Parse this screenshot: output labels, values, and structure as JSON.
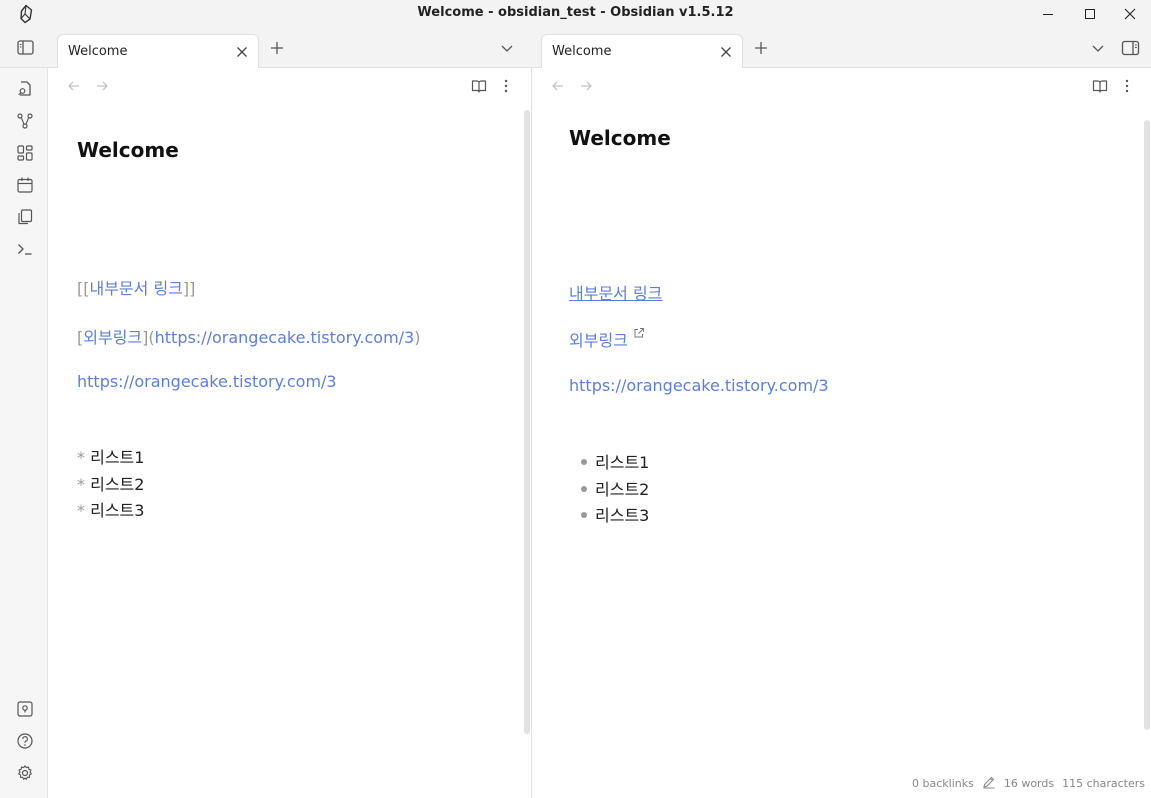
{
  "window": {
    "title": "Welcome - obsidian_test - Obsidian v1.5.12"
  },
  "icons": {
    "app_logo": "obsidian-logo-icon",
    "minimize": "minimize-icon",
    "maximize": "maximize-icon",
    "close": "close-icon",
    "sidebar_toggle": "left-sidebar-toggle-icon",
    "new_tab": "plus-icon",
    "tab_list": "chevron-down-icon",
    "right_sidebar_toggle": "right-sidebar-toggle-icon",
    "back": "arrow-left-icon",
    "forward": "arrow-right-icon",
    "reading_mode": "book-open-icon",
    "more": "more-vertical-icon",
    "edit": "pencil-icon"
  },
  "tabs": {
    "left": {
      "label": "Welcome"
    },
    "right": {
      "label": "Welcome"
    }
  },
  "ribbon": {
    "top_items": [
      "open-quick-switcher-icon",
      "graph-view-icon",
      "canvas-icon",
      "daily-notes-icon",
      "templates-icon",
      "command-palette-icon"
    ],
    "bottom_items": [
      "vault-switcher-icon",
      "help-icon",
      "settings-icon"
    ]
  },
  "editor": {
    "title": "Welcome",
    "internal_link": {
      "open": "[[",
      "text": "내부문서 링크",
      "close": "]]"
    },
    "external_link": {
      "open_bracket": "[",
      "text": "외부링크",
      "mid": "](",
      "url": "https://orangecake.tistory.com/3",
      "close": ")"
    },
    "bare_url": "https://orangecake.tistory.com/3",
    "list_marker": "*",
    "list_items": [
      "리스트1",
      "리스트2",
      "리스트3"
    ]
  },
  "reading": {
    "title": "Welcome",
    "internal_link": "내부문서 링크",
    "external_link": "외부링크",
    "bare_url": "https://orangecake.tistory.com/3",
    "list_items": [
      "리스트1",
      "리스트2",
      "리스트3"
    ]
  },
  "status": {
    "backlinks": "0 backlinks",
    "words": "16 words",
    "characters": "115 characters"
  },
  "colors": {
    "link": "#5c7fd9",
    "syntax": "#9a9a9a",
    "chrome": "#f3f3f3"
  }
}
